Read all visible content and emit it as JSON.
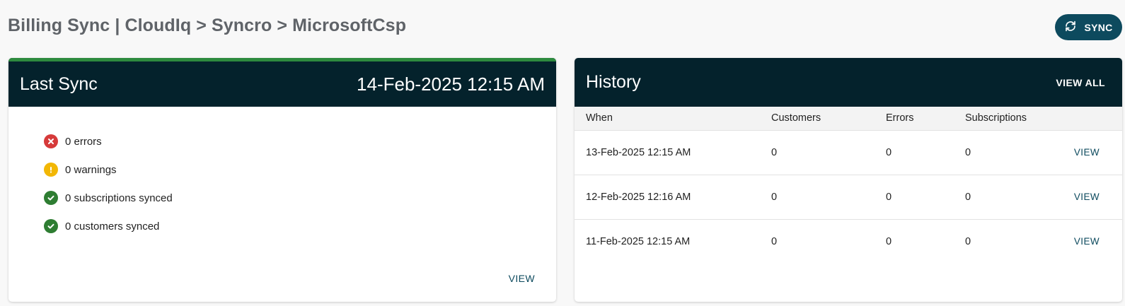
{
  "header": {
    "title": "Billing Sync | CloudIq > Syncro > MicrosoftCsp",
    "sync_label": "SYNC"
  },
  "last_sync": {
    "title": "Last Sync",
    "date": "14-Feb-2025 12:15 AM",
    "statuses": [
      {
        "text": "0 errors",
        "icon": "error-icon",
        "color": "#d63a3a"
      },
      {
        "text": "0 warnings",
        "icon": "warning-icon",
        "color": "#f2b705"
      },
      {
        "text": "0 subscriptions synced",
        "icon": "check-icon",
        "color": "#2e7d32"
      },
      {
        "text": "0 customers synced",
        "icon": "check-icon",
        "color": "#2e7d32"
      }
    ],
    "view_label": "VIEW"
  },
  "history": {
    "title": "History",
    "view_all_label": "VIEW ALL",
    "columns": [
      "When",
      "Customers",
      "Errors",
      "Subscriptions"
    ],
    "rows": [
      {
        "when": "13-Feb-2025 12:15 AM",
        "customers": "0",
        "errors": "0",
        "subscriptions": "0",
        "action": "VIEW"
      },
      {
        "when": "12-Feb-2025 12:16 AM",
        "customers": "0",
        "errors": "0",
        "subscriptions": "0",
        "action": "VIEW"
      },
      {
        "when": "11-Feb-2025 12:15 AM",
        "customers": "0",
        "errors": "0",
        "subscriptions": "0",
        "action": "VIEW"
      }
    ]
  },
  "colors": {
    "primary": "#0d4a5e",
    "header_dark": "#04222c",
    "success_accent": "#2e8b3f"
  }
}
